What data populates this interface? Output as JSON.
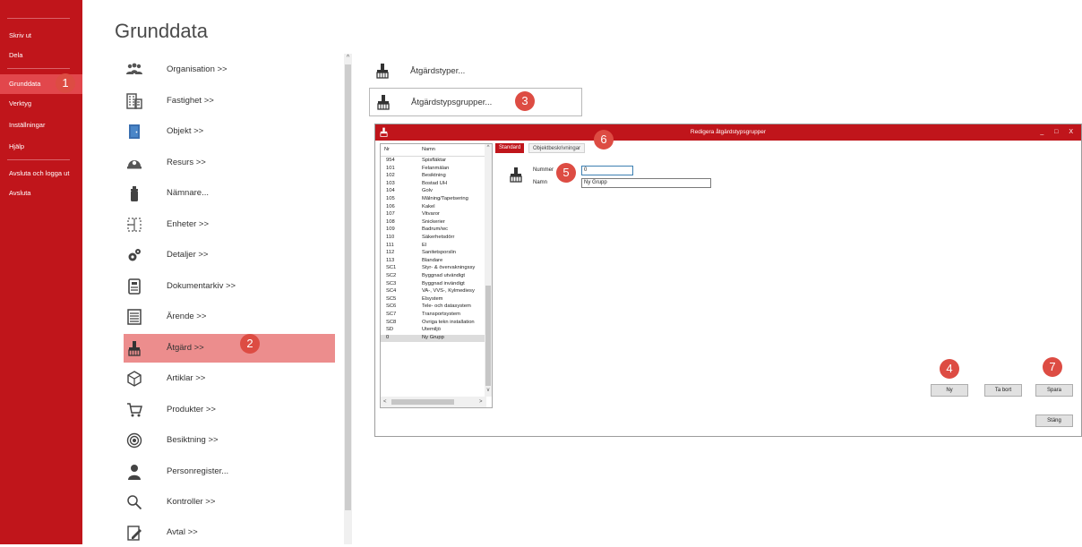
{
  "sidebar": {
    "items": [
      {
        "label": "Skriv ut"
      },
      {
        "label": "Dela"
      },
      {
        "label": "Grunddata"
      },
      {
        "label": "Verktyg"
      },
      {
        "label": "Inställningar"
      },
      {
        "label": "Hjälp"
      },
      {
        "label": "Avsluta och logga ut"
      },
      {
        "label": "Avsluta"
      }
    ]
  },
  "page": {
    "title": "Grunddata"
  },
  "categories": [
    {
      "label": "Organisation >>",
      "icon": "group-icon"
    },
    {
      "label": "Fastighet >>",
      "icon": "building-icon"
    },
    {
      "label": "Objekt >>",
      "icon": "door-icon"
    },
    {
      "label": "Resurs >>",
      "icon": "helmet-icon"
    },
    {
      "label": "Nämnare...",
      "icon": "fire-extinguisher-icon"
    },
    {
      "label": "Enheter >>",
      "icon": "units-icon"
    },
    {
      "label": "Detaljer >>",
      "icon": "gears-icon"
    },
    {
      "label": "Dokumentarkiv >>",
      "icon": "archive-icon"
    },
    {
      "label": "Ärende >>",
      "icon": "form-icon"
    },
    {
      "label": "Åtgärd >>",
      "icon": "brush-icon"
    },
    {
      "label": "Artiklar >>",
      "icon": "cube-icon"
    },
    {
      "label": "Produkter >>",
      "icon": "cart-icon"
    },
    {
      "label": "Besiktning >>",
      "icon": "eye-icon"
    },
    {
      "label": "Personregister...",
      "icon": "person-icon"
    },
    {
      "label": "Kontroller >>",
      "icon": "magnifier-icon"
    },
    {
      "label": "Avtal >>",
      "icon": "contract-icon"
    }
  ],
  "right_items": [
    {
      "label": "Åtgärdstyper..."
    },
    {
      "label": "Åtgärdstypsgrupper..."
    }
  ],
  "badges": [
    "1",
    "2",
    "3",
    "4",
    "5",
    "6",
    "7"
  ],
  "dialog": {
    "title": "Redigera åtgärdstypsgrupper",
    "controls": "_ □ X",
    "list": {
      "col_nr": "Nr",
      "col_namn": "Namn",
      "rows": [
        {
          "nr": "954",
          "namn": "Spisfläktar"
        },
        {
          "nr": "101",
          "namn": "Felanmälan"
        },
        {
          "nr": "102",
          "namn": "Besiktning"
        },
        {
          "nr": "103",
          "namn": "Bostad UH"
        },
        {
          "nr": "104",
          "namn": "Golv"
        },
        {
          "nr": "105",
          "namn": "Målning/Tapetsering"
        },
        {
          "nr": "106",
          "namn": "Kakel"
        },
        {
          "nr": "107",
          "namn": "Vitvaror"
        },
        {
          "nr": "108",
          "namn": "Snickerier"
        },
        {
          "nr": "109",
          "namn": "Badrum/wc"
        },
        {
          "nr": "110",
          "namn": "Säkerhetsdörr"
        },
        {
          "nr": "111",
          "namn": "El"
        },
        {
          "nr": "112",
          "namn": "Sanitetsporslin"
        },
        {
          "nr": "113",
          "namn": "Blandare"
        },
        {
          "nr": "SC1",
          "namn": "Styr- & övervakningssy"
        },
        {
          "nr": "SC2",
          "namn": "Byggnad utvändigt"
        },
        {
          "nr": "SC3",
          "namn": "Byggnad invändigt"
        },
        {
          "nr": "SC4",
          "namn": "VA-, VVS-, Kylmediesy"
        },
        {
          "nr": "SC5",
          "namn": "Elsystem"
        },
        {
          "nr": "SC6",
          "namn": "Tele- och datasystem"
        },
        {
          "nr": "SC7",
          "namn": "Transportsystem"
        },
        {
          "nr": "SC8",
          "namn": "Övriga tekn installation"
        },
        {
          "nr": "SD",
          "namn": "Utemiljö"
        },
        {
          "nr": "0",
          "namn": "Ny Grupp"
        }
      ]
    },
    "tabs": [
      {
        "label": "Standard"
      },
      {
        "label": "Objektbeskrivningar"
      }
    ],
    "form": {
      "nummer_label": "Nummer",
      "nummer_value": "0",
      "namn_label": "Namn",
      "namn_value": "Ny Grupp"
    },
    "buttons": {
      "ny": "Ny",
      "ta_bort": "Ta bort",
      "spara": "Spara",
      "stang": "Stäng"
    }
  },
  "colors": {
    "brand_red": "#c0151b",
    "badge": "#dd4c43",
    "highlight": "#ec8d8d"
  }
}
